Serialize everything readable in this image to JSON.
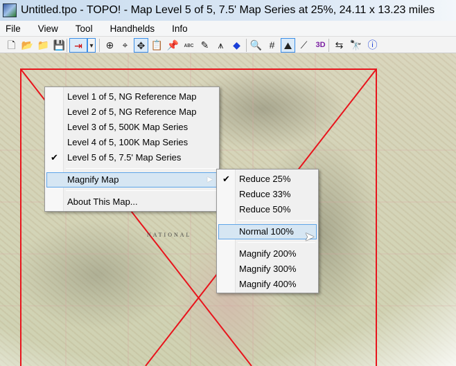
{
  "window": {
    "title": "Untitled.tpo - TOPO! - Map Level 5 of 5, 7.5' Map Series at 25%, 24.11 x 13.23 miles"
  },
  "menubar": [
    "File",
    "View",
    "Tool",
    "Handhelds",
    "Info"
  ],
  "toolbar": [
    {
      "icon": "new-icon",
      "glyph": "🗋"
    },
    {
      "icon": "open-icon",
      "glyph": "📂"
    },
    {
      "icon": "open-folder-icon",
      "glyph": "📁"
    },
    {
      "icon": "save-icon",
      "glyph": "💾"
    },
    {
      "icon": "route-export-icon",
      "glyph": "⇥"
    },
    {
      "icon": "dropdown-arrow-icon",
      "glyph": "▾"
    },
    {
      "icon": "zoom-in-icon",
      "glyph": "⊕"
    },
    {
      "icon": "center-icon",
      "glyph": "⌖"
    },
    {
      "icon": "pan-icon",
      "glyph": "✥"
    },
    {
      "icon": "clipboard-icon",
      "glyph": "📋"
    },
    {
      "icon": "pushpin-icon",
      "glyph": "📌"
    },
    {
      "icon": "text-icon",
      "glyph": "ᴀʙᴄ"
    },
    {
      "icon": "ruler-pencil-icon",
      "glyph": "✎"
    },
    {
      "icon": "north-arrow-icon",
      "glyph": "⩚"
    },
    {
      "icon": "waypoint-icon",
      "glyph": "◆"
    },
    {
      "icon": "search-icon",
      "glyph": "🔍"
    },
    {
      "icon": "grid-icon",
      "glyph": "#"
    },
    {
      "icon": "shaded-relief-icon",
      "glyph": "⛰"
    },
    {
      "icon": "profile-icon",
      "glyph": "⟋"
    },
    {
      "icon": "3d-icon",
      "glyph": "3D"
    },
    {
      "icon": "gps-transfer-icon",
      "glyph": "⇆"
    },
    {
      "icon": "binoculars-icon",
      "glyph": "🔭"
    },
    {
      "icon": "info-icon",
      "glyph": "ⓘ"
    }
  ],
  "context_menu": {
    "items": [
      {
        "label": "Level 1 of 5, NG Reference Map",
        "checked": false
      },
      {
        "label": "Level 2 of 5, NG Reference Map",
        "checked": false
      },
      {
        "label": "Level 3 of 5, 500K Map Series",
        "checked": false
      },
      {
        "label": "Level 4 of 5, 100K Map Series",
        "checked": false
      },
      {
        "label": "Level 5 of 5, 7.5' Map Series",
        "checked": true
      }
    ],
    "magnify": "Magnify Map",
    "about": "About This Map...",
    "check": "✔"
  },
  "submenu": {
    "items": [
      "Reduce 25%",
      "Reduce 33%",
      "Reduce 50%",
      "Normal 100%",
      "Magnify 200%",
      "Magnify 300%",
      "Magnify 400%"
    ],
    "checked": "Reduce 25%",
    "highlighted": "Normal 100%"
  },
  "map": {
    "label": "NATIONAL",
    "boundary_color": "#e8141c"
  }
}
